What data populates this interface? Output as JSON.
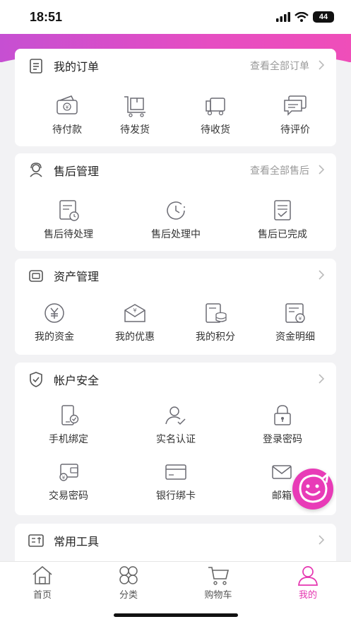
{
  "status": {
    "time": "18:51",
    "battery": "44"
  },
  "orders": {
    "title": "我的订单",
    "more": "查看全部订单",
    "items": [
      {
        "label": "待付款",
        "icon": "wallet-icon"
      },
      {
        "label": "待发货",
        "icon": "cart-box-icon"
      },
      {
        "label": "待收货",
        "icon": "truck-icon"
      },
      {
        "label": "待评价",
        "icon": "comment-icon"
      }
    ]
  },
  "aftersale": {
    "title": "售后管理",
    "more": "查看全部售后",
    "items": [
      {
        "label": "售后待处理",
        "icon": "doc-clock-icon"
      },
      {
        "label": "售后处理中",
        "icon": "clock-icon"
      },
      {
        "label": "售后已完成",
        "icon": "doc-check-icon"
      }
    ]
  },
  "assets": {
    "title": "资产管理",
    "items": [
      {
        "label": "我的资金",
        "icon": "yuan-coin-icon"
      },
      {
        "label": "我的优惠",
        "icon": "coupon-icon"
      },
      {
        "label": "我的积分",
        "icon": "points-icon"
      },
      {
        "label": "资金明细",
        "icon": "ledger-icon"
      }
    ]
  },
  "security": {
    "title": "帐户安全",
    "items": [
      {
        "label": "手机绑定",
        "icon": "phone-check-icon"
      },
      {
        "label": "实名认证",
        "icon": "user-check-icon"
      },
      {
        "label": "登录密码",
        "icon": "lock-icon"
      },
      {
        "label": "交易密码",
        "icon": "wallet-key-icon"
      },
      {
        "label": "银行绑卡",
        "icon": "card-icon"
      },
      {
        "label": "邮箱",
        "icon": "mail-icon"
      }
    ]
  },
  "tools": {
    "title": "常用工具"
  },
  "tabs": [
    {
      "label": "首页",
      "icon": "home-icon"
    },
    {
      "label": "分类",
      "icon": "category-icon"
    },
    {
      "label": "购物车",
      "icon": "cart-icon"
    },
    {
      "label": "我的",
      "icon": "user-icon"
    }
  ],
  "colors": {
    "accent": "#e535b0",
    "icon_gray": "#6b6b73",
    "bg": "#f2f2f4"
  }
}
